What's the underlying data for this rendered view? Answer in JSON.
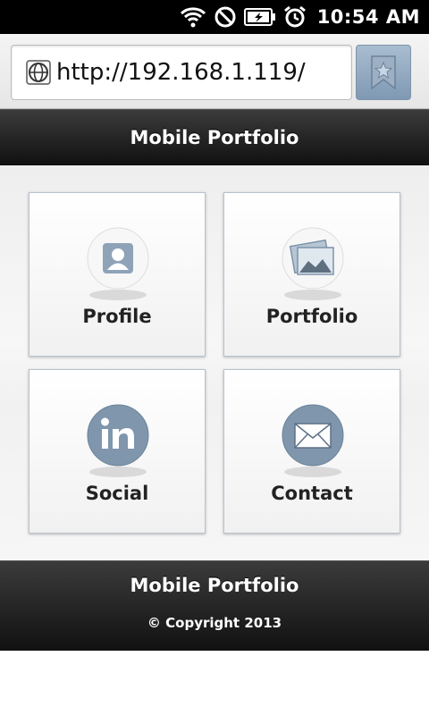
{
  "status_bar": {
    "time": "10:54 AM",
    "icons": [
      "wifi-icon",
      "silent-mode-icon",
      "battery-charging-icon",
      "alarm-icon"
    ]
  },
  "browser": {
    "url": "http://192.168.1.119/",
    "page_icon": "globe-icon",
    "bookmark_icon": "bookmark-star-icon"
  },
  "header": {
    "title": "Mobile Portfolio"
  },
  "tiles": [
    {
      "label": "Profile",
      "icon": "profile-icon"
    },
    {
      "label": "Portfolio",
      "icon": "photos-icon"
    },
    {
      "label": "Social",
      "icon": "linkedin-icon"
    },
    {
      "label": "Contact",
      "icon": "envelope-icon"
    }
  ],
  "footer": {
    "title": "Mobile Portfolio",
    "copyright": "© Copyright 2013"
  },
  "colors": {
    "header_bg": "#1f1f1f",
    "icon_blue": "#7f96ad",
    "tile_border": "#b9c2cc"
  }
}
